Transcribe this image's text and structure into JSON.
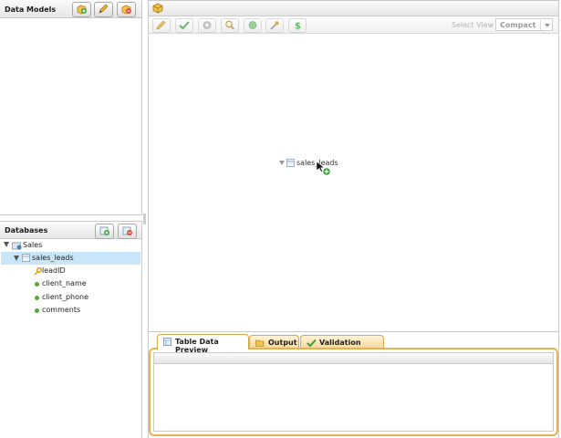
{
  "left_panel": {
    "data_models": {
      "title": "Data Models",
      "buttons": [
        {
          "icon": "add-model-icon"
        },
        {
          "icon": "edit-model-icon"
        },
        {
          "icon": "delete-model-icon"
        }
      ]
    },
    "databases": {
      "title": "Databases",
      "buttons": [
        {
          "icon": "add-database-icon"
        },
        {
          "icon": "remove-database-icon"
        }
      ],
      "tree": {
        "root": {
          "label": "Sales",
          "expanded": true
        },
        "table": {
          "label": "sales_leads",
          "expanded": true,
          "selected": true
        },
        "fields": [
          {
            "label": "leadID",
            "icon": "key-icon"
          },
          {
            "label": "client_name",
            "icon": "field-dot-icon"
          },
          {
            "label": "client_phone",
            "icon": "field-dot-icon"
          },
          {
            "label": "comments",
            "icon": "field-dot-icon"
          }
        ]
      }
    }
  },
  "right_panel": {
    "header_icon": "cube-icon",
    "toolbar": {
      "buttons": [
        "pencil-icon",
        "check-icon",
        "gear-icon",
        "magnify-icon",
        "refresh-icon",
        "wrench-icon",
        "dollar-icon"
      ],
      "select_view_label": "Select View",
      "select_view_value": "Compact"
    },
    "canvas": {
      "node_label": "sales_leads"
    },
    "bottom_tabs": [
      {
        "label": "Table Data Preview",
        "icon": "table-icon",
        "active": true
      },
      {
        "label": "Output",
        "icon": "folder-icon",
        "active": false
      },
      {
        "label": "Validation Errors",
        "icon": "check-icon",
        "active": false
      }
    ]
  },
  "colors": {
    "selection": "#c8e6fa",
    "tab_border": "#d8a84a",
    "tab_fill": "#f6d79a"
  }
}
